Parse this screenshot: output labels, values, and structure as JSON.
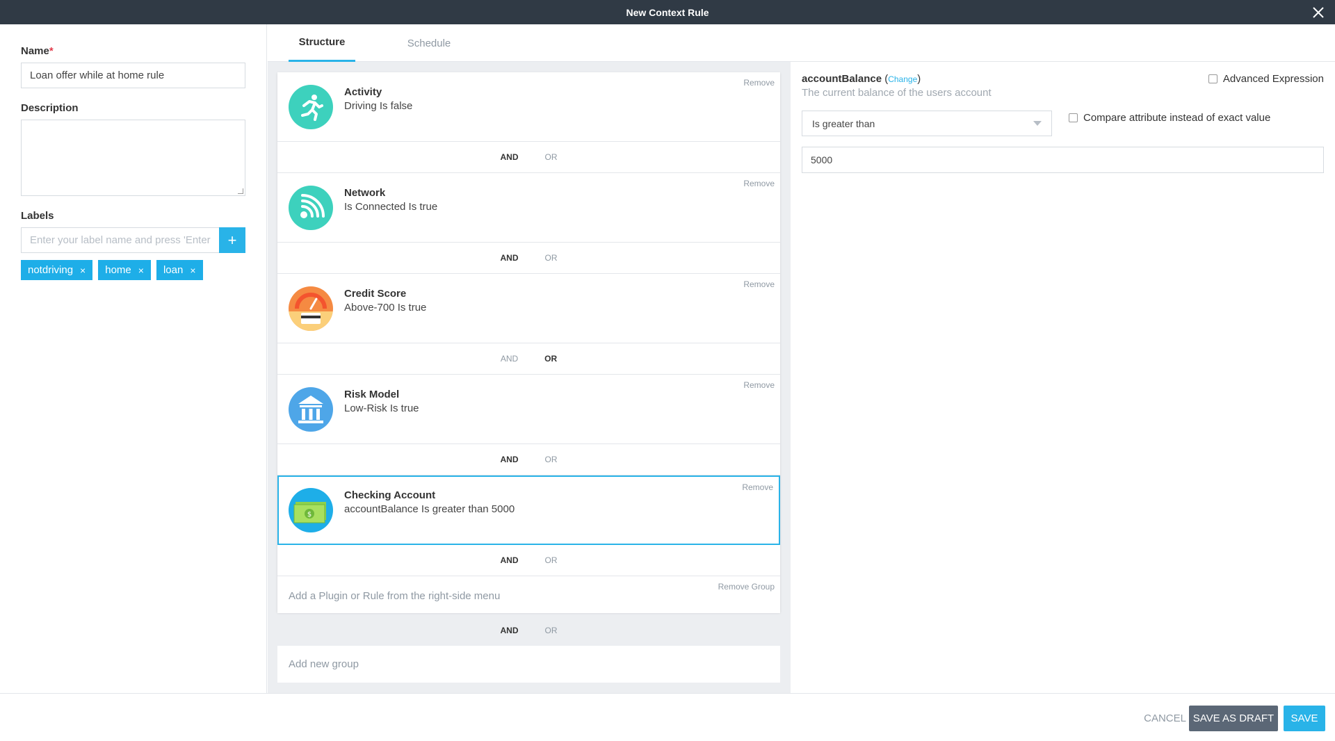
{
  "window": {
    "title": "New Context Rule"
  },
  "form": {
    "name_label": "Name",
    "name_required_mark": "*",
    "name_value": "Loan offer while at home rule",
    "description_label": "Description",
    "labels_label": "Labels",
    "labels_placeholder": "Enter your label name and press 'Enter",
    "add_label_symbol": "+",
    "tags": [
      {
        "text": "notdriving",
        "remove": "×"
      },
      {
        "text": "home",
        "remove": "×"
      },
      {
        "text": "loan",
        "remove": "×"
      }
    ]
  },
  "tabs": [
    {
      "label": "Structure",
      "active": true
    },
    {
      "label": "Schedule",
      "active": false
    }
  ],
  "structure": {
    "remove_label": "Remove",
    "and_label": "AND",
    "or_label": "OR",
    "rules": [
      {
        "title": "Activity",
        "description": "Driving Is false",
        "icon": "running-icon",
        "icon_color": "#3dd1bd",
        "connector": "AND"
      },
      {
        "title": "Network",
        "description": "Is Connected Is true",
        "icon": "wifi-icon",
        "icon_color": "#3dd1bd",
        "connector": "AND"
      },
      {
        "title": "Credit Score",
        "description": "Above-700 Is true",
        "icon": "credit-gauge-icon",
        "icon_color": "#f58a42",
        "connector": "OR"
      },
      {
        "title": "Risk Model",
        "description": "Low-Risk Is true",
        "icon": "bank-icon",
        "icon_color": "#4ea6e8",
        "connector": "AND"
      },
      {
        "title": "Checking Account",
        "description": "accountBalance Is greater than 5000",
        "icon": "money-icon",
        "icon_color": "#1eaee8",
        "selected": true,
        "connector": "AND"
      }
    ],
    "add_plugin_placeholder": "Add a Plugin or Rule from the right-side menu",
    "remove_group_label": "Remove Group",
    "group_connector": "AND",
    "add_group_placeholder": "Add new group"
  },
  "attribute": {
    "name": "accountBalance",
    "change_label": "Change",
    "paren_open": " (",
    "paren_close": ")",
    "description": "The current balance of the users account",
    "advanced_label": "Advanced Expression",
    "operator_value": "Is greater than",
    "compare_label": "Compare attribute instead of exact value",
    "value": "5000"
  },
  "footer": {
    "cancel_label": "CANCEL",
    "draft_label": "SAVE AS DRAFT",
    "save_label": "SAVE"
  },
  "colors": {
    "titlebar": "#303a45",
    "accent": "#29b3e8",
    "tag": "#1eaee8",
    "draft_button": "#5b6776",
    "required": "#e23b4b"
  }
}
